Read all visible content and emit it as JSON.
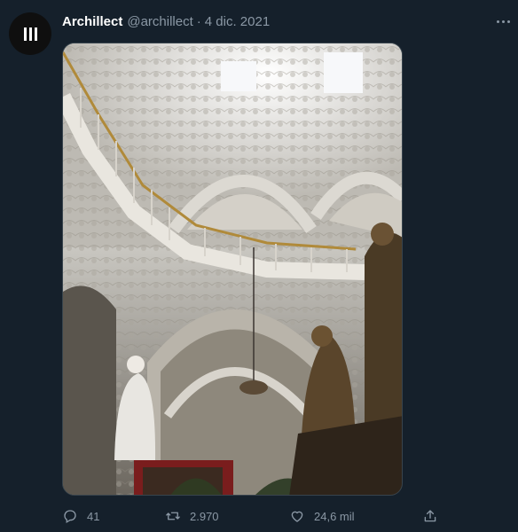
{
  "author": {
    "display_name": "Archillect",
    "handle": "@archillect",
    "separator": "·",
    "date": "4 dic. 2021"
  },
  "media": {
    "description_icon": "photo"
  },
  "actions": {
    "replies": "41",
    "retweets": "2.970",
    "likes": "24,6 mil"
  },
  "colors": {
    "background": "#15202b",
    "secondary_text": "#8b98a5",
    "border": "#38444d"
  }
}
